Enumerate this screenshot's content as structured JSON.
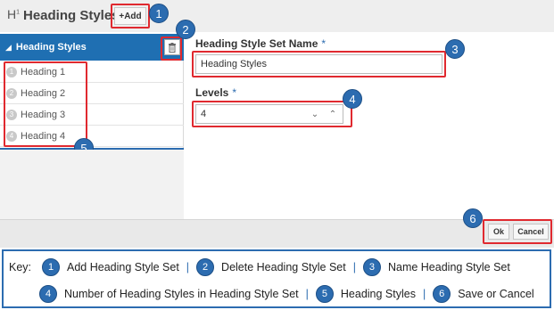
{
  "header": {
    "icon": "heading-icon",
    "title": "Heading Styles",
    "add_label": "+Add"
  },
  "left_panel": {
    "group_title": "Heading Styles",
    "trash_icon": "trash-icon",
    "items": [
      {
        "num": "1",
        "label": "Heading 1"
      },
      {
        "num": "2",
        "label": "Heading 2"
      },
      {
        "num": "3",
        "label": "Heading 3"
      },
      {
        "num": "4",
        "label": "Heading 4"
      }
    ]
  },
  "form": {
    "name_label": "Heading Style Set Name",
    "name_required": "*",
    "name_value": "Heading Styles",
    "levels_label": "Levels",
    "levels_required": "*",
    "levels_value": "4"
  },
  "footer": {
    "ok_label": "Ok",
    "cancel_label": "Cancel"
  },
  "callouts": [
    "1",
    "2",
    "3",
    "4",
    "5",
    "6"
  ],
  "key": {
    "prefix": "Key:",
    "separator": "|",
    "entries": [
      {
        "num": "1",
        "text": "Add Heading Style Set"
      },
      {
        "num": "2",
        "text": "Delete Heading Style Set"
      },
      {
        "num": "3",
        "text": "Name Heading Style Set"
      },
      {
        "num": "4",
        "text": "Number of Heading Styles in Heading Style Set"
      },
      {
        "num": "5",
        "text": "Heading Styles"
      },
      {
        "num": "6",
        "text": "Save or Cancel"
      }
    ]
  },
  "colors": {
    "accent_blue": "#1f6fb2",
    "callout_red": "#e0292f",
    "badge_blue": "#2c6cb0"
  }
}
